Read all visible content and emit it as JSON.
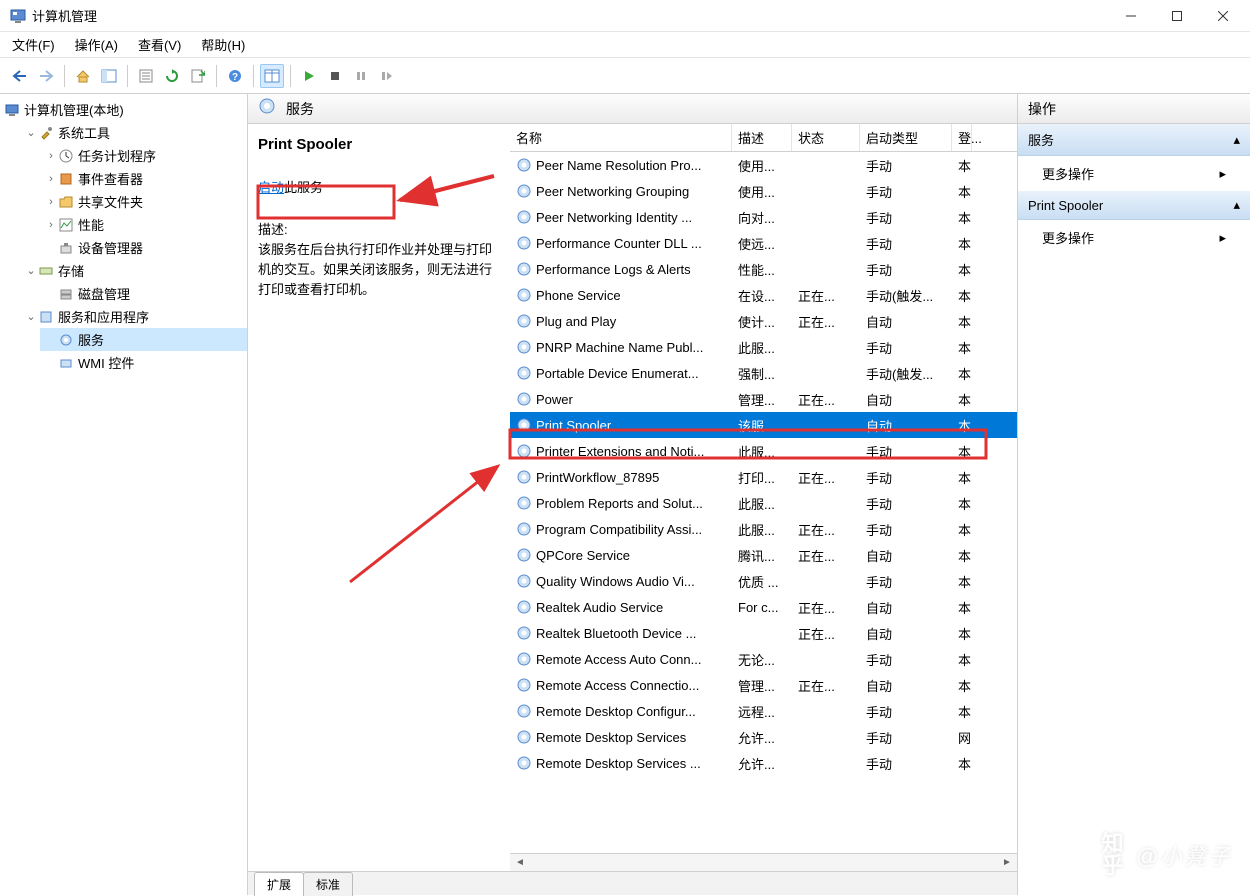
{
  "window": {
    "title": "计算机管理",
    "min": "—",
    "max": "◻",
    "close": "✕"
  },
  "menu": {
    "file": "文件(F)",
    "action": "操作(A)",
    "view": "查看(V)",
    "help": "帮助(H)"
  },
  "tree": {
    "root": "计算机管理(本地)",
    "system_tools": "系统工具",
    "task_scheduler": "任务计划程序",
    "event_viewer": "事件查看器",
    "shared_folders": "共享文件夹",
    "performance": "性能",
    "device_manager": "设备管理器",
    "storage": "存储",
    "disk_management": "磁盘管理",
    "services_apps": "服务和应用程序",
    "services": "服务",
    "wmi": "WMI 控件"
  },
  "center": {
    "header": "服务",
    "selected_service": "Print Spooler",
    "start_link": "启动",
    "start_suffix": "此服务",
    "desc_label": "描述:",
    "desc_text": "该服务在后台执行打印作业并处理与打印机的交互。如果关闭该服务，则无法进行打印或查看打印机。",
    "columns": {
      "name": "名称",
      "desc": "描述",
      "status": "状态",
      "startup": "启动类型",
      "logon": "登..."
    },
    "tabs": {
      "extended": "扩展",
      "standard": "标准"
    }
  },
  "services": [
    {
      "name": "Peer Name Resolution Pro...",
      "desc": "使用...",
      "status": "",
      "startup": "手动",
      "logon": "本"
    },
    {
      "name": "Peer Networking Grouping",
      "desc": "使用...",
      "status": "",
      "startup": "手动",
      "logon": "本"
    },
    {
      "name": "Peer Networking Identity ...",
      "desc": "向对...",
      "status": "",
      "startup": "手动",
      "logon": "本"
    },
    {
      "name": "Performance Counter DLL ...",
      "desc": "使远...",
      "status": "",
      "startup": "手动",
      "logon": "本"
    },
    {
      "name": "Performance Logs & Alerts",
      "desc": "性能...",
      "status": "",
      "startup": "手动",
      "logon": "本"
    },
    {
      "name": "Phone Service",
      "desc": "在设...",
      "status": "正在...",
      "startup": "手动(触发...",
      "logon": "本"
    },
    {
      "name": "Plug and Play",
      "desc": "使计...",
      "status": "正在...",
      "startup": "自动",
      "logon": "本"
    },
    {
      "name": "PNRP Machine Name Publ...",
      "desc": "此服...",
      "status": "",
      "startup": "手动",
      "logon": "本"
    },
    {
      "name": "Portable Device Enumerat...",
      "desc": "强制...",
      "status": "",
      "startup": "手动(触发...",
      "logon": "本"
    },
    {
      "name": "Power",
      "desc": "管理...",
      "status": "正在...",
      "startup": "自动",
      "logon": "本"
    },
    {
      "name": "Print Spooler",
      "desc": "该服...",
      "status": "",
      "startup": "自动",
      "logon": "本",
      "selected": true
    },
    {
      "name": "Printer Extensions and Noti...",
      "desc": "此服...",
      "status": "",
      "startup": "手动",
      "logon": "本"
    },
    {
      "name": "PrintWorkflow_87895",
      "desc": "打印...",
      "status": "正在...",
      "startup": "手动",
      "logon": "本"
    },
    {
      "name": "Problem Reports and Solut...",
      "desc": "此服...",
      "status": "",
      "startup": "手动",
      "logon": "本"
    },
    {
      "name": "Program Compatibility Assi...",
      "desc": "此服...",
      "status": "正在...",
      "startup": "手动",
      "logon": "本"
    },
    {
      "name": "QPCore Service",
      "desc": "腾讯...",
      "status": "正在...",
      "startup": "自动",
      "logon": "本"
    },
    {
      "name": "Quality Windows Audio Vi...",
      "desc": "优质 ...",
      "status": "",
      "startup": "手动",
      "logon": "本"
    },
    {
      "name": "Realtek Audio Service",
      "desc": "For c...",
      "status": "正在...",
      "startup": "自动",
      "logon": "本"
    },
    {
      "name": "Realtek Bluetooth Device ...",
      "desc": "",
      "status": "正在...",
      "startup": "自动",
      "logon": "本"
    },
    {
      "name": "Remote Access Auto Conn...",
      "desc": "无论...",
      "status": "",
      "startup": "手动",
      "logon": "本"
    },
    {
      "name": "Remote Access Connectio...",
      "desc": "管理...",
      "status": "正在...",
      "startup": "自动",
      "logon": "本"
    },
    {
      "name": "Remote Desktop Configur...",
      "desc": "远程...",
      "status": "",
      "startup": "手动",
      "logon": "本"
    },
    {
      "name": "Remote Desktop Services",
      "desc": "允许...",
      "status": "",
      "startup": "手动",
      "logon": "网"
    },
    {
      "name": "Remote Desktop Services ...",
      "desc": "允许...",
      "status": "",
      "startup": "手动",
      "logon": "本"
    }
  ],
  "actions": {
    "header": "操作",
    "group1_title": "服务",
    "group1_item": "更多操作",
    "group2_title": "Print Spooler",
    "group2_item": "更多操作"
  },
  "watermark": "@小凳子"
}
